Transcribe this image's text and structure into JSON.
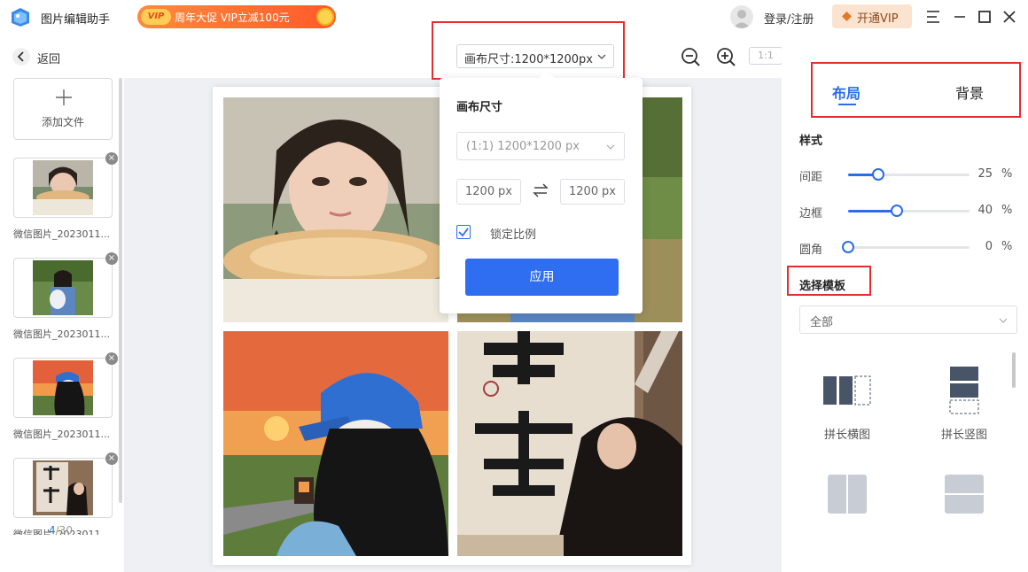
{
  "app": {
    "name": "图片编辑助手",
    "promo_vip_tag": "VIP",
    "promo_text": "周年大促 VIP立减100元",
    "login": "登录/注册",
    "open_vip": "开通VIP"
  },
  "left": {
    "back": "返回",
    "add_file": "添加文件",
    "files": [
      {
        "name": "微信图片_2023011..."
      },
      {
        "name": "微信图片_2023011..."
      },
      {
        "name": "微信图片_2023011..."
      },
      {
        "name": "微信图片_2023011..."
      }
    ],
    "page_current": "4",
    "page_total": "/30"
  },
  "toolbar": {
    "canvas_size_label": "画布尺寸:1200*1200px",
    "ratio_label": "1:1"
  },
  "popup": {
    "title": "画布尺寸",
    "preset": "(1:1) 1200*1200 px",
    "width": "1200",
    "height": "1200",
    "unit": "px",
    "lock_label": "锁定比例",
    "lock_checked": true,
    "apply": "应用"
  },
  "right": {
    "tab_layout": "布局",
    "tab_background": "背景",
    "style_label": "样式",
    "sliders": [
      {
        "label": "间距",
        "value": "25",
        "unit": "%",
        "fraction": 0.25
      },
      {
        "label": "边框",
        "value": "40",
        "unit": "%",
        "fraction": 0.4
      },
      {
        "label": "圆角",
        "value": "0",
        "unit": "%",
        "fraction": 0.0
      }
    ],
    "template_label": "选择模板",
    "template_filter": "全部",
    "templates": [
      {
        "name": "拼长横图"
      },
      {
        "name": "拼长竖图"
      },
      {
        "name": ""
      },
      {
        "name": ""
      }
    ]
  },
  "colors": {
    "accent": "#2a6de8",
    "highlight": "#e52d2d",
    "promo": "#ff6a2f"
  }
}
